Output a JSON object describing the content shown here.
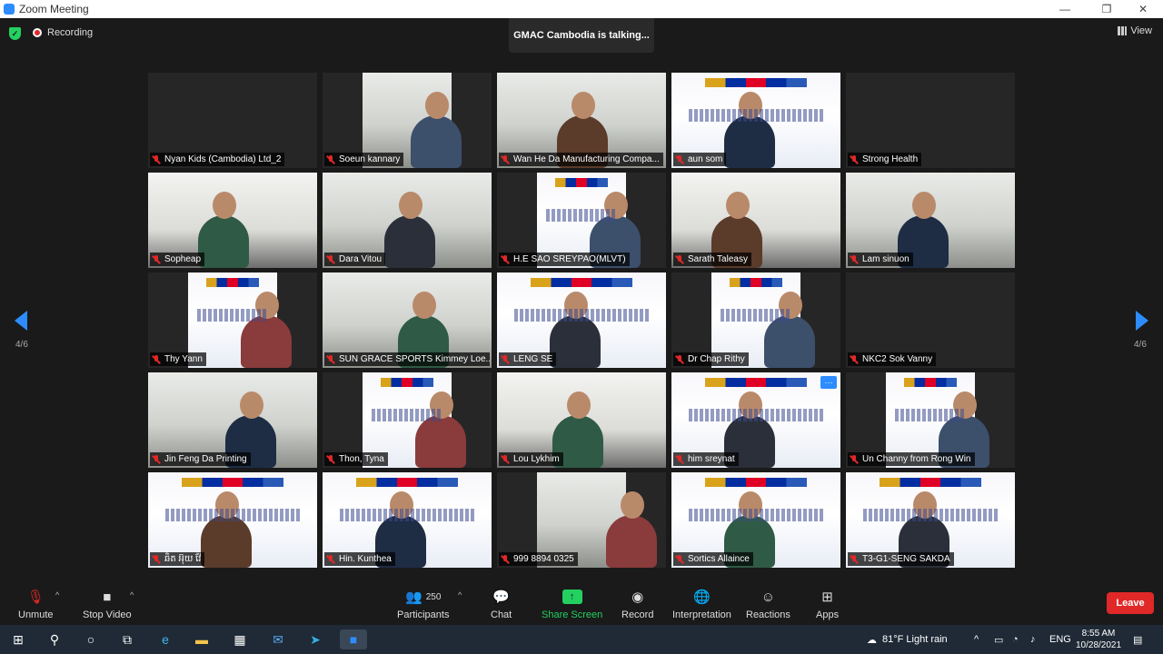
{
  "window": {
    "title": "Zoom Meeting",
    "minimize": "—",
    "maximize": "❐",
    "close": "✕"
  },
  "top": {
    "recording": "Recording",
    "talking": "GMAC Cambodia is talking...",
    "view": "View"
  },
  "pager": {
    "left": "4/6",
    "right": "4/6"
  },
  "tiles": [
    {
      "name": "Nyan Kids (Cambodia) Ltd_2",
      "bg": "blank"
    },
    {
      "name": "Soeun kannary",
      "bg": "room"
    },
    {
      "name": "Wan He Da Manufacturing Compa...",
      "bg": "room"
    },
    {
      "name": "aun som",
      "bg": "banner"
    },
    {
      "name": "Strong Health",
      "bg": "blank"
    },
    {
      "name": "Sopheap",
      "bg": "office"
    },
    {
      "name": "Dara Vitou",
      "bg": "room"
    },
    {
      "name": "H.E SAO SREYPAO(MLVT)",
      "bg": "banner"
    },
    {
      "name": "Sarath Taleasy",
      "bg": "office"
    },
    {
      "name": "Lam sinuon",
      "bg": "room"
    },
    {
      "name": "Thy Yann",
      "bg": "banner"
    },
    {
      "name": "SUN GRACE SPORTS Kimmey Loe...",
      "bg": "room"
    },
    {
      "name": "LENG SE",
      "bg": "banner"
    },
    {
      "name": "Dr Chap Rithy",
      "bg": "banner"
    },
    {
      "name": "NKC2 Sok Vanny",
      "bg": "blank"
    },
    {
      "name": "Jin Feng Da Printing",
      "bg": "room"
    },
    {
      "name": "Thon, Tyna",
      "bg": "banner"
    },
    {
      "name": "Lou Lykhim",
      "bg": "office"
    },
    {
      "name": "him sreynat",
      "bg": "banner"
    },
    {
      "name": "Un Channy from Rong Win",
      "bg": "banner"
    },
    {
      "name": "ឆិត អ៊ុយ វ៉ែ",
      "bg": "banner"
    },
    {
      "name": "Hin. Kunthea",
      "bg": "banner"
    },
    {
      "name": "999 8894 0325",
      "bg": "room"
    },
    {
      "name": "Sortics Allaince",
      "bg": "banner"
    },
    {
      "name": "T3-G1-SENG SAKDA",
      "bg": "banner"
    }
  ],
  "tile_more": "···",
  "toolbar": {
    "unmute": "Unmute",
    "stop_video": "Stop Video",
    "participants_count": "250",
    "participants": "Participants",
    "chat": "Chat",
    "share_screen": "Share Screen",
    "record": "Record",
    "interpretation": "Interpretation",
    "reactions": "Reactions",
    "apps": "Apps",
    "leave": "Leave"
  },
  "taskbar": {
    "weather": "81°F  Light rain",
    "lang": "ENG",
    "time": "8:55 AM",
    "date": "10/28/2021"
  },
  "colors": {
    "accent": "#2d8cff",
    "green": "#23d160",
    "red": "#e02828"
  }
}
